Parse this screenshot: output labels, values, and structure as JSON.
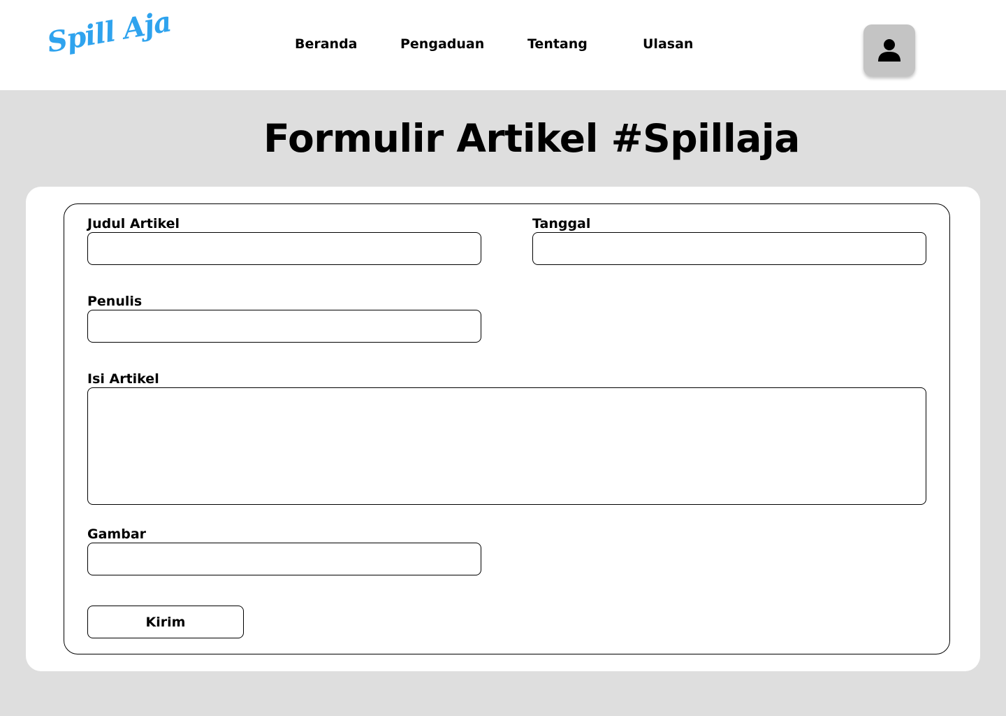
{
  "header": {
    "logo_text": "Spill Aja",
    "logo_color": "#2fa3ee",
    "nav": [
      {
        "label": "Beranda"
      },
      {
        "label": "Pengaduan"
      },
      {
        "label": "Tentang"
      },
      {
        "label": "Ulasan"
      }
    ],
    "profile_icon": "user-icon"
  },
  "page": {
    "title": "Formulir Artikel #Spillaja",
    "background_color": "#dedede"
  },
  "form": {
    "judul_label": "Judul Artikel",
    "judul_value": "",
    "tanggal_label": "Tanggal",
    "tanggal_value": "",
    "penulis_label": "Penulis",
    "penulis_value": "",
    "isi_label": "Isi Artikel",
    "isi_value": "",
    "gambar_label": "Gambar",
    "gambar_value": "",
    "submit_label": "Kirim"
  }
}
